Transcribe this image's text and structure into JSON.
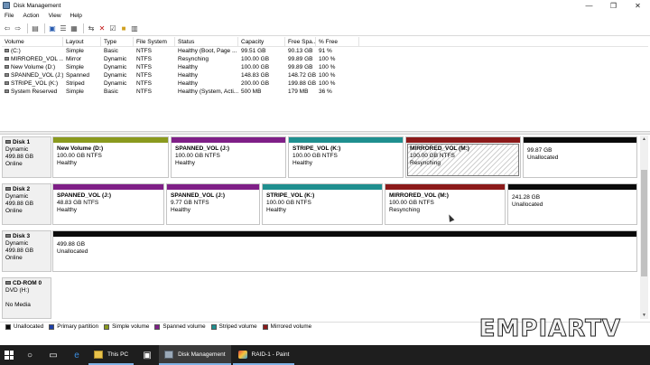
{
  "window": {
    "title": "Disk Management",
    "controls": [
      "—",
      "❐",
      "✕"
    ]
  },
  "menu": [
    "File",
    "Action",
    "View",
    "Help"
  ],
  "volume_table": {
    "headers": [
      "Volume",
      "Layout",
      "Type",
      "File System",
      "Status",
      "Capacity",
      "Free Spa...",
      "% Free"
    ],
    "rows": [
      [
        "(C:)",
        "Simple",
        "Basic",
        "NTFS",
        "Healthy (Boot, Page ...",
        "99.51 GB",
        "90.13 GB",
        "91 %"
      ],
      [
        "MIRRORED_VOL ...",
        "Mirror",
        "Dynamic",
        "NTFS",
        "Resynching",
        "100.00 GB",
        "99.89 GB",
        "100 %"
      ],
      [
        "New Volume (D:)",
        "Simple",
        "Dynamic",
        "NTFS",
        "Healthy",
        "100.00 GB",
        "99.89 GB",
        "100 %"
      ],
      [
        "SPANNED_VOL (J:)",
        "Spanned",
        "Dynamic",
        "NTFS",
        "Healthy",
        "148.83 GB",
        "148.72 GB",
        "100 %"
      ],
      [
        "STRIPE_VOL (K:)",
        "Striped",
        "Dynamic",
        "NTFS",
        "Healthy",
        "200.00 GB",
        "199.88 GB",
        "100 %"
      ],
      [
        "System Reserved",
        "Simple",
        "Basic",
        "NTFS",
        "Healthy (System, Acti...",
        "500 MB",
        "179 MB",
        "36 %"
      ]
    ]
  },
  "disks": [
    {
      "name": "Disk 1",
      "type": "Dynamic",
      "size": "499.88 GB",
      "state": "Online",
      "partitions": [
        {
          "name": "New Volume  (D:)",
          "size": "100.00 GB NTFS",
          "status": "Healthy",
          "color": "#8a9a1e"
        },
        {
          "name": "SPANNED_VOL  (J:)",
          "size": "100.00 GB NTFS",
          "status": "Healthy",
          "color": "#7f1f87"
        },
        {
          "name": "STRIPE_VOL  (K:)",
          "size": "100.00 GB NTFS",
          "status": "Healthy",
          "color": "#1f8f8f"
        },
        {
          "name": "MIRRORED_VOL  (M:)",
          "size": "100.00 GB NTFS",
          "status": "Resynching",
          "color": "#8b1a1a"
        },
        {
          "name": "",
          "size": "99.87 GB",
          "status": "Unallocated",
          "color": "#0a0a0a"
        }
      ]
    },
    {
      "name": "Disk 2",
      "type": "Dynamic",
      "size": "499.88 GB",
      "state": "Online",
      "partitions": [
        {
          "name": "SPANNED_VOL  (J:)",
          "size": "48.83 GB NTFS",
          "status": "Healthy",
          "color": "#7f1f87"
        },
        {
          "name": "SPANNED_VOL  (J:)",
          "size": "9.77 GB NTFS",
          "status": "Healthy",
          "color": "#7f1f87"
        },
        {
          "name": "STRIPE_VOL  (K:)",
          "size": "100.00 GB NTFS",
          "status": "Healthy",
          "color": "#1f8f8f"
        },
        {
          "name": "MIRRORED_VOL  (M:)",
          "size": "100.00 GB NTFS",
          "status": "Resynching",
          "color": "#8b1a1a"
        },
        {
          "name": "",
          "size": "241.28 GB",
          "status": "Unallocated",
          "color": "#0a0a0a"
        }
      ]
    },
    {
      "name": "Disk 3",
      "type": "Dynamic",
      "size": "499.88 GB",
      "state": "Online",
      "partitions": [
        {
          "name": "",
          "size": "499.88 GB",
          "status": "Unallocated",
          "color": "#0a0a0a"
        }
      ]
    },
    {
      "name": "CD-ROM 0",
      "type": "DVD (H:)",
      "size": "",
      "state": "No Media",
      "partitions": []
    }
  ],
  "legend": [
    {
      "label": "Unallocated",
      "color": "#0a0a0a"
    },
    {
      "label": "Primary partition",
      "color": "#1c3fa8"
    },
    {
      "label": "Simple volume",
      "color": "#8a9a1e"
    },
    {
      "label": "Spanned volume",
      "color": "#7f1f87"
    },
    {
      "label": "Striped volume",
      "color": "#1f8f8f"
    },
    {
      "label": "Mirrored volume",
      "color": "#8b1a1a"
    }
  ],
  "taskbar": {
    "tasks": [
      {
        "label": "This PC",
        "icon": "folder-icon"
      },
      {
        "label": "Disk Management",
        "icon": "disk-management-icon"
      },
      {
        "label": "RAID-1 - Paint",
        "icon": "paint-icon"
      }
    ]
  },
  "watermark": "EMPIARTV"
}
